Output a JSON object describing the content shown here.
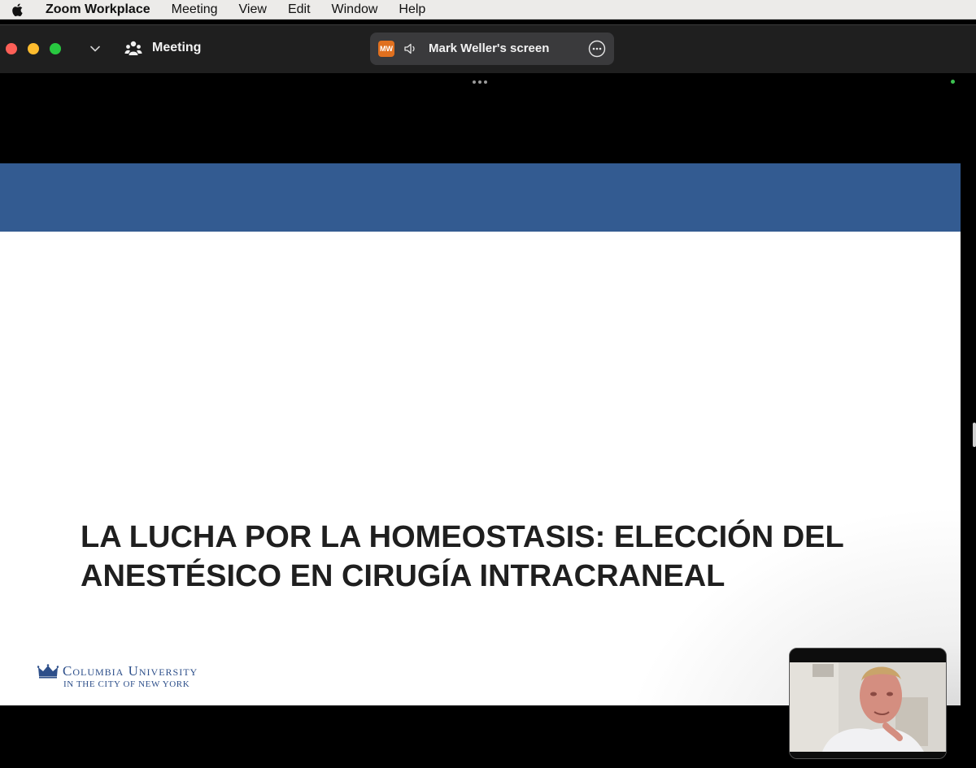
{
  "menubar": {
    "app_name": "Zoom Workplace",
    "items": [
      "Meeting",
      "View",
      "Edit",
      "Window",
      "Help"
    ]
  },
  "titlebar": {
    "meeting_label": "Meeting",
    "share": {
      "initials": "MW",
      "label": "Mark Weller's screen"
    }
  },
  "slide": {
    "title_line1": "LA LUCHA POR LA HOMEOSTASIS: ELECCIÓN DEL",
    "title_line2": "ANESTÉSICO EN CIRUGÍA INTRACRANEAL",
    "logo_main": "Columbia University",
    "logo_sub": "IN THE CITY OF NEW YORK"
  },
  "colors": {
    "accent_band": "#335b91",
    "share_badge": "#e0701f",
    "traffic_red": "#fe5f57",
    "traffic_yellow": "#febc2e",
    "traffic_green": "#28c840"
  },
  "icons": [
    "apple-icon",
    "chevron-down-icon",
    "participants-icon",
    "speaker-icon",
    "more-options-icon",
    "crown-icon"
  ]
}
